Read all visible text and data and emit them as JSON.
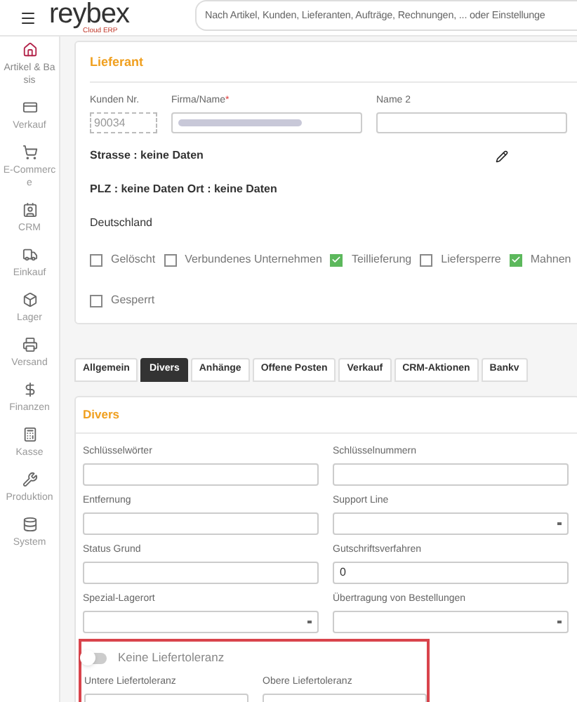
{
  "header": {
    "logo": "reybex",
    "logo_sub": "Cloud ERP",
    "search": {
      "placeholder": "Nach Artikel, Kunden, Lieferanten, Aufträge, Rechnungen, ... oder Einstellunge"
    }
  },
  "sidebar": {
    "items": [
      {
        "label": "Artikel & Basis",
        "selected": true
      },
      {
        "label": "Verkauf",
        "selected": false
      },
      {
        "label": "E-Commerce",
        "selected": false
      },
      {
        "label": "CRM",
        "selected": false
      },
      {
        "label": "Einkauf",
        "selected": false
      },
      {
        "label": "Lager",
        "selected": false
      },
      {
        "label": "Versand",
        "selected": false
      },
      {
        "label": "Finanzen",
        "selected": false
      },
      {
        "label": "Kasse",
        "selected": false
      },
      {
        "label": "Produktion",
        "selected": false
      },
      {
        "label": "System",
        "selected": false
      }
    ]
  },
  "supplier": {
    "title": "Lieferant",
    "customer_no": {
      "label": "Kunden Nr.",
      "value": "90034"
    },
    "company": {
      "label": "Firma/Name",
      "required_mark": "*"
    },
    "name2": {
      "label": "Name 2"
    },
    "address": [
      "Strasse : keine Daten",
      "PLZ : keine Daten Ort : keine Daten",
      "Deutschland"
    ],
    "flags": [
      {
        "label": "Gelöscht",
        "checked": false
      },
      {
        "label": "Verbundenes Unternehmen",
        "checked": false
      },
      {
        "label": "Teillieferung",
        "checked": true
      },
      {
        "label": "Liefersperre",
        "checked": false
      },
      {
        "label": "Mahnen",
        "checked": true
      },
      {
        "label": "Gesperrt",
        "checked": false
      }
    ]
  },
  "tabs": [
    {
      "label": "Allgemein",
      "selected": false
    },
    {
      "label": "Divers",
      "selected": true
    },
    {
      "label": "Anhänge",
      "selected": false
    },
    {
      "label": "Offene Posten",
      "selected": false
    },
    {
      "label": "Verkauf",
      "selected": false
    },
    {
      "label": "CRM-Aktionen",
      "selected": false
    },
    {
      "label": "Bankv",
      "selected": false
    }
  ],
  "divers": {
    "title": "Divers",
    "fields": [
      {
        "label": "Schlüsselwörter",
        "kind": "text"
      },
      {
        "label": "Schlüsselnummern",
        "kind": "text"
      },
      {
        "label": "Entfernung",
        "kind": "text"
      },
      {
        "label": "Support Line",
        "kind": "select"
      },
      {
        "label": "Status Grund",
        "kind": "text"
      },
      {
        "label": "Gutschriftsverfahren",
        "kind": "text",
        "value": "0"
      },
      {
        "label": "Spezial-Lagerort",
        "kind": "select"
      },
      {
        "label": "Übertragung von Bestellungen",
        "kind": "select"
      }
    ],
    "tolerance": {
      "label": "Keine Liefertoleranz",
      "on": false,
      "fields": [
        {
          "label": "Untere Liefertoleranz"
        },
        {
          "label": "Obere Liefertoleranz"
        }
      ]
    }
  }
}
